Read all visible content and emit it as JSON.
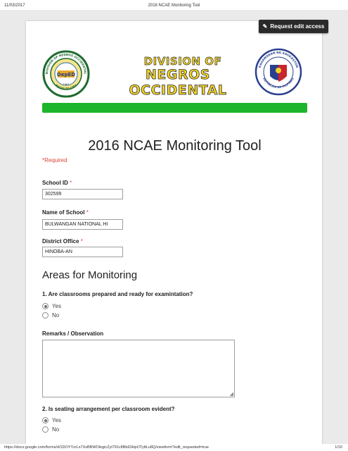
{
  "print_header": {
    "date": "11/03/2017",
    "title": "2016 NCAE Monitoring Tool"
  },
  "edit_button": {
    "label": "Request edit access",
    "icon": "pencil-icon"
  },
  "banner": {
    "line1": "DIVISION OF",
    "line2": "NEGROS OCCIDENTAL",
    "left_seal": {
      "top_text": "DIVISION OF NEGROS OCCIDENTAL",
      "bottom_text": "BACOLOD CITY",
      "center_text": "DepED",
      "year": "1963"
    },
    "right_seal": {
      "top_text": "KAGAWARAN NG EDUKASYON",
      "bottom_text": "REPUBLIKA NG PILIPINAS"
    },
    "accent_color": "#1db52c"
  },
  "form": {
    "title": "2016 NCAE Monitoring Tool",
    "required_note": "*Required"
  },
  "fields": [
    {
      "label": "School ID",
      "value": "302599",
      "required": true
    },
    {
      "label": "Name of School",
      "value": "BULWANGAN NATIONAL HI",
      "required": true
    },
    {
      "label": "District Office",
      "value": "HINOBA-AN",
      "required": true
    }
  ],
  "section": {
    "title": "Areas for Monitoring"
  },
  "questions": [
    {
      "label": "1. Are classrooms prepared and ready for examintation?",
      "options": [
        {
          "label": "Yes",
          "selected": true
        },
        {
          "label": "No",
          "selected": false
        }
      ]
    },
    {
      "label": "Remarks / Observation",
      "value": ""
    },
    {
      "label": "2. Is seating arrangement per classroom evident?",
      "options": [
        {
          "label": "Yes",
          "selected": true
        },
        {
          "label": "No",
          "selected": false
        }
      ]
    }
  ],
  "print_footer": {
    "url": "https://docs.google.com/forms/d/1DOYYzrLs7XsBBWOlegicZyI791c8Bb63HpOTyttLu8Q/viewform?edit_requested=true",
    "page": "1/10"
  }
}
